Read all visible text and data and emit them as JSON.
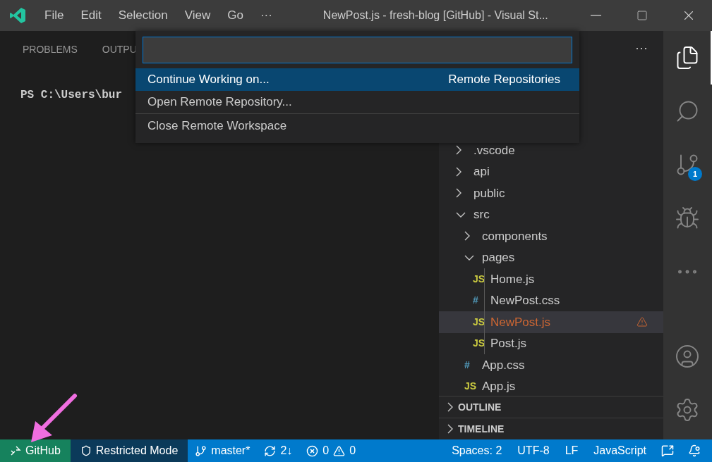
{
  "title_bar": {
    "menu": [
      "File",
      "Edit",
      "Selection",
      "View",
      "Go",
      "···"
    ],
    "title": "NewPost.js - fresh-blog [GitHub] - Visual St..."
  },
  "panel": {
    "tabs": [
      "PROBLEMS",
      "OUTPU"
    ],
    "terminal_line": "PS C:\\Users\\bur"
  },
  "quick_pick": {
    "items": [
      {
        "label": "Continue Working on...",
        "detail": "Remote Repositories",
        "selected": true,
        "separator_above": false
      },
      {
        "label": "Open Remote Repository...",
        "selected": false,
        "separator_above": false
      },
      {
        "label": "Close Remote Workspace",
        "selected": false,
        "separator_above": true
      }
    ]
  },
  "explorer": {
    "more": "···",
    "tree": [
      {
        "label": ".vscode",
        "kind": "folder",
        "expanded": false
      },
      {
        "label": "api",
        "kind": "folder",
        "expanded": false
      },
      {
        "label": "public",
        "kind": "folder",
        "expanded": false
      },
      {
        "label": "src",
        "kind": "folder",
        "expanded": true,
        "children": [
          {
            "label": "components",
            "kind": "folder",
            "expanded": false
          },
          {
            "label": "pages",
            "kind": "folder",
            "expanded": true,
            "children": [
              {
                "label": "Home.js",
                "kind": "js",
                "icon_text": "JS",
                "selected": false,
                "warning": false
              },
              {
                "label": "NewPost.css",
                "kind": "css",
                "icon_text": "#",
                "selected": false,
                "warning": false
              },
              {
                "label": "NewPost.js",
                "kind": "js",
                "icon_text": "JS",
                "selected": true,
                "warning": true
              },
              {
                "label": "Post.js",
                "kind": "js",
                "icon_text": "JS",
                "selected": false,
                "warning": false
              }
            ]
          },
          {
            "label": "App.css",
            "kind": "css",
            "icon_text": "#",
            "selected": false,
            "warning": false
          },
          {
            "label": "App.js",
            "kind": "js",
            "icon_text": "JS",
            "selected": false,
            "warning": false
          }
        ]
      }
    ],
    "sections": [
      {
        "label": "OUTLINE",
        "expanded": false
      },
      {
        "label": "TIMELINE",
        "expanded": false
      }
    ]
  },
  "activity_bar": [
    {
      "kind": "explorer",
      "selected": true
    },
    {
      "kind": "search",
      "selected": false
    },
    {
      "kind": "source-control",
      "selected": false,
      "badge": "1"
    },
    {
      "kind": "run-debug",
      "selected": false
    },
    {
      "kind": "more",
      "selected": false
    },
    {
      "kind": "spacer"
    },
    {
      "kind": "account",
      "selected": false
    },
    {
      "kind": "settings",
      "selected": false
    }
  ],
  "status_bar": [
    {
      "kind": "remote",
      "text": "GitHub"
    },
    {
      "kind": "restricted",
      "text": "Restricted Mode"
    },
    {
      "kind": "branch",
      "text": "master*"
    },
    {
      "kind": "sync",
      "text": "2↓"
    },
    {
      "kind": "problems",
      "errors": "0",
      "warnings": "0"
    },
    {
      "kind": "spacer"
    },
    {
      "kind": "plain",
      "text": "Spaces: 2"
    },
    {
      "kind": "plain",
      "text": "UTF-8"
    },
    {
      "kind": "plain",
      "text": "LF"
    },
    {
      "kind": "plain",
      "text": "JavaScript"
    },
    {
      "kind": "feedback"
    },
    {
      "kind": "bell"
    }
  ]
}
